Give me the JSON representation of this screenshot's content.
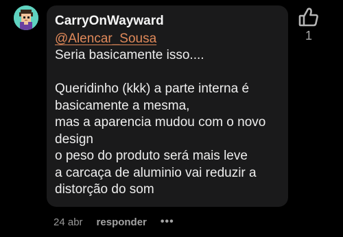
{
  "comment": {
    "avatar_icon": "pixel-character-avatar",
    "author": "CarryOnWayward",
    "mention": "@Alencar_Sousa",
    "lines": [
      "Seria basicamente isso....",
      "",
      "Queridinho (kkk) a parte interna é",
      "basicamente a mesma,",
      "mas a aparencia mudou com o novo",
      "design",
      "o peso do produto será mais leve",
      "a carcaça de aluminio vai reduzir a",
      "distorção do som"
    ],
    "likes": "1",
    "like_icon": "thumbs-up-icon",
    "date": "24 abr",
    "reply_label": "responder",
    "more_label": "•••",
    "colors": {
      "background": "#000000",
      "bubble": "#1a1a1b",
      "mention": "#e0895a",
      "avatar_bg": "#5fd3c0"
    }
  }
}
